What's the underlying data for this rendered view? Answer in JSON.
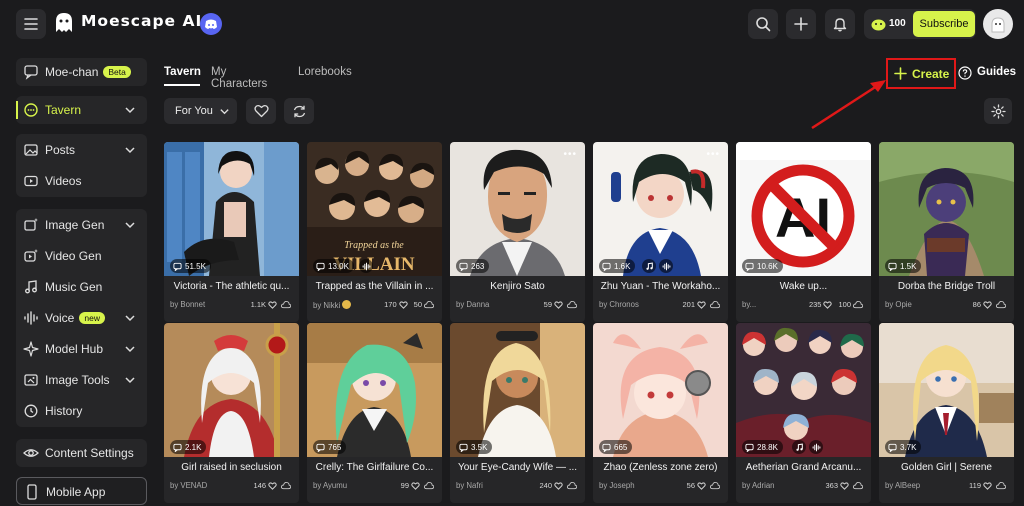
{
  "brand": {
    "name": "Moescape AI"
  },
  "header": {
    "coins": "100",
    "subscribe_label": "Subscribe"
  },
  "sidebar": {
    "moe_chan": {
      "label": "Moe-chan",
      "badge": "Beta"
    },
    "tavern": {
      "label": "Tavern"
    },
    "posts": {
      "label": "Posts"
    },
    "videos": {
      "label": "Videos"
    },
    "image_gen": {
      "label": "Image Gen"
    },
    "video_gen": {
      "label": "Video Gen"
    },
    "music_gen": {
      "label": "Music Gen"
    },
    "voice": {
      "label": "Voice",
      "badge": "new"
    },
    "model_hub": {
      "label": "Model Hub"
    },
    "image_tools": {
      "label": "Image Tools"
    },
    "history": {
      "label": "History"
    },
    "content_settings": {
      "label": "Content Settings"
    },
    "mobile_app": {
      "label": "Mobile App"
    }
  },
  "tabs": [
    {
      "label": "Tavern"
    },
    {
      "label": "My Characters"
    },
    {
      "label": "Lorebooks"
    }
  ],
  "toolbar": {
    "sort_label": "For You",
    "create_label": "Create",
    "guides_label": "Guides"
  },
  "cards": [
    {
      "title": "Victoria - The athletic qu...",
      "author": "by Bonnet",
      "chats": "51.5K",
      "likes": "1.1K",
      "extra": "",
      "music": false,
      "voice": false,
      "menu": false
    },
    {
      "title": "Trapped as the Villain in ...",
      "author": "by Nikki",
      "chats": "13.0K",
      "likes": "170",
      "extra": "50",
      "music": false,
      "voice": true,
      "menu": false,
      "caption": "Trapped as the VILLAIN"
    },
    {
      "title": "Kenjiro Sato",
      "author": "by Danna",
      "chats": "263",
      "likes": "59",
      "extra": "",
      "music": false,
      "voice": false,
      "menu": true
    },
    {
      "title": "Zhu Yuan - The Workaho...",
      "author": "by Chronos",
      "chats": "1.6K",
      "likes": "201",
      "extra": "",
      "music": true,
      "voice": true,
      "menu": true
    },
    {
      "title": "Wake up...",
      "author": "by...",
      "chats": "10.6K",
      "likes": "235",
      "extra": "100",
      "music": false,
      "voice": false,
      "menu": false,
      "caption": "AI"
    },
    {
      "title": "Dorba the Bridge Troll",
      "author": "by Opie",
      "chats": "1.5K",
      "likes": "86",
      "extra": "",
      "music": false,
      "voice": false,
      "menu": false
    },
    {
      "title": "Girl raised in seclusion",
      "author": "by VENAD",
      "chats": "2.1K",
      "likes": "146",
      "extra": "",
      "music": false,
      "voice": false,
      "menu": false
    },
    {
      "title": "Crelly: The Girlfailure Co...",
      "author": "by Ayumu",
      "chats": "765",
      "likes": "99",
      "extra": "",
      "music": false,
      "voice": false,
      "menu": false
    },
    {
      "title": "Your Eye-Candy Wife — ...",
      "author": "by Nafri",
      "chats": "3.5K",
      "likes": "240",
      "extra": "",
      "music": false,
      "voice": false,
      "menu": false
    },
    {
      "title": "Zhao (Zenless zone zero)",
      "author": "by Joseph",
      "chats": "665",
      "likes": "56",
      "extra": "",
      "music": false,
      "voice": false,
      "menu": false
    },
    {
      "title": "Aetherian Grand Arcanu...",
      "author": "by Adrian",
      "chats": "28.8K",
      "likes": "363",
      "extra": "",
      "music": true,
      "voice": true,
      "menu": false
    },
    {
      "title": "Golden Girl | Serene",
      "author": "by AlBeep",
      "chats": "3.7K",
      "likes": "119",
      "extra": "",
      "music": false,
      "voice": false,
      "menu": false
    }
  ],
  "colors": {
    "accent": "#d7f34b",
    "background": "#1b1b1d",
    "panel": "#262628",
    "annotation": "#e01818"
  }
}
